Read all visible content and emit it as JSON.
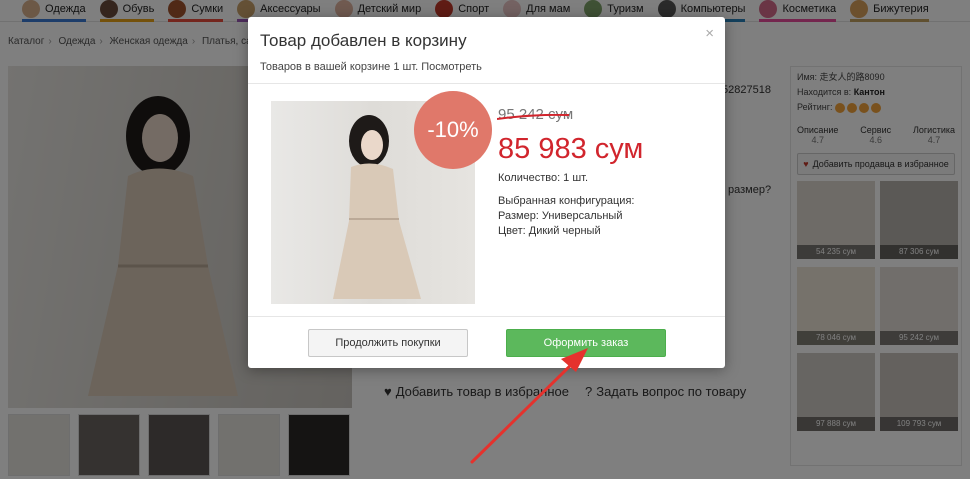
{
  "nav": {
    "items": [
      {
        "label": "Одежда",
        "color": "#d9b08c",
        "bar": "#3a7bd5"
      },
      {
        "label": "Обувь",
        "color": "#6b4a3a",
        "bar": "#e8a317"
      },
      {
        "label": "Сумки",
        "color": "#a0522d",
        "bar": "#e84c3d"
      },
      {
        "label": "Аксессуары",
        "color": "#c8a16a",
        "bar": "#9b59b6"
      },
      {
        "label": "Детский мир",
        "color": "#e0b4a0",
        "bar": "#2ecc71"
      },
      {
        "label": "Спорт",
        "color": "#c0392b",
        "bar": "#f39c12"
      },
      {
        "label": "Для мам",
        "color": "#e8c4c4",
        "bar": "#e91e63"
      },
      {
        "label": "Туризм",
        "color": "#7fa36a",
        "bar": "#16a085"
      },
      {
        "label": "Компьютеры",
        "color": "#555555",
        "bar": "#2980b9"
      },
      {
        "label": "Косметика",
        "color": "#d46a8a",
        "bar": "#e84c9d"
      },
      {
        "label": "Бижутерия",
        "color": "#d9a05b",
        "bar": "#c0a060"
      }
    ]
  },
  "breadcrumb": [
    "Каталог",
    "Одежда",
    "Женская одежда",
    "Платья, сар"
  ],
  "product_code_partial": "52827518",
  "ask_size_partial": "размер?",
  "links": {
    "add_favorite": "Добавить товар в избранное",
    "ask_question": "Задать вопрос по товару"
  },
  "seller": {
    "name_label": "Имя:",
    "name_value": "走女人的路8090",
    "location_label": "Находится в:",
    "location_value": "Кантон",
    "rating_label": "Рейтинг:",
    "ratings": [
      {
        "label": "Описание",
        "value": "4.7"
      },
      {
        "label": "Сервис",
        "value": "4.6"
      },
      {
        "label": "Логистика",
        "value": "4.7"
      }
    ],
    "fav_button": "Добавить продавца в избранное",
    "recommended": [
      {
        "price": "54 235 сум"
      },
      {
        "price": "87 306 сум"
      },
      {
        "price": "78 046 сум"
      },
      {
        "price": "95 242 сум"
      },
      {
        "price": "97 888 сум"
      },
      {
        "price": "109 793 сум"
      }
    ]
  },
  "modal": {
    "title": "Товар добавлен в корзину",
    "subtitle": "Товаров в вашей корзине 1 шт.",
    "subtitle_link": "Посмотреть",
    "close": "×",
    "discount": "-10%",
    "old_price": "95 242 сум",
    "new_price": "85 983 сум",
    "quantity": "Количество: 1 шт.",
    "config_title": "Выбранная конфигурация:",
    "size": "Размер: Универсальный",
    "color": "Цвет: Дикий черный",
    "continue_button": "Продолжить покупки",
    "order_button": "Оформить заказ"
  },
  "colors": {
    "price_red": "#d1252d",
    "badge": "#e0786a",
    "order_green": "#5cb85c",
    "arrow_red": "#e5322d"
  }
}
